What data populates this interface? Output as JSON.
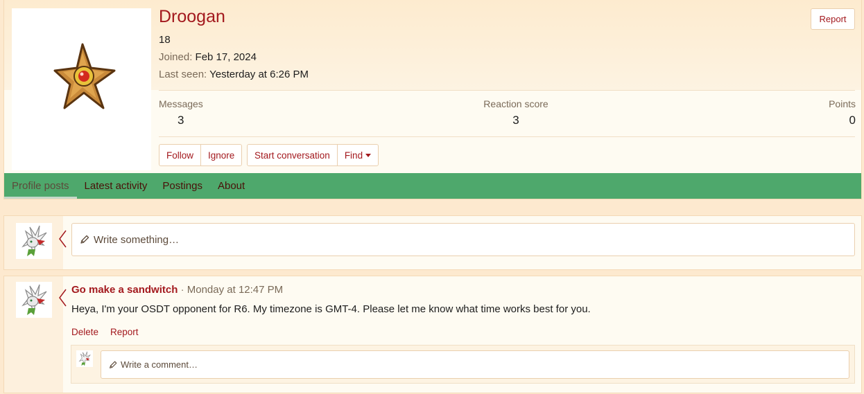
{
  "profile": {
    "username": "Droogan",
    "user_title": "18",
    "joined_label": "Joined:",
    "joined_value": "Feb 17, 2024",
    "last_seen_label": "Last seen:",
    "last_seen_value": "Yesterday at 6:26 PM",
    "report_label": "Report",
    "avatar_icon": "staryu-avatar-icon"
  },
  "stats": {
    "messages_label": "Messages",
    "messages_value": "3",
    "reaction_label": "Reaction score",
    "reaction_value": "3",
    "points_label": "Points",
    "points_value": "0"
  },
  "actions": {
    "follow": "Follow",
    "ignore": "Ignore",
    "start_conversation": "Start conversation",
    "find": "Find"
  },
  "tabs": [
    {
      "label": "Profile posts",
      "active": true
    },
    {
      "label": "Latest activity",
      "active": false
    },
    {
      "label": "Postings",
      "active": false
    },
    {
      "label": "About",
      "active": false
    }
  ],
  "composer": {
    "placeholder": "Write something…"
  },
  "post": {
    "author": "Go make a sandwitch",
    "separator": "·",
    "time": "Monday at 12:47 PM",
    "body": "Heya, I'm your OSDT opponent for R6. My timezone is GMT-4. Please let me know what time works best for you.",
    "delete_label": "Delete",
    "report_label": "Report",
    "comment_placeholder": "Write a comment…"
  },
  "colors": {
    "brand_red": "#a3191e",
    "tab_green": "#4ea86c",
    "page_bg": "#fde9cf"
  }
}
